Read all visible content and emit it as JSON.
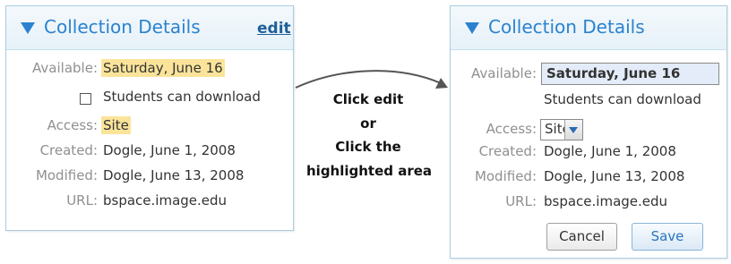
{
  "left_panel": {
    "title": "Collection Details",
    "edit_label": "edit",
    "available_label": "Available:",
    "available_value": "Saturday, June 16",
    "download_label": "Students can download",
    "access_label": "Access:",
    "access_value": "Site",
    "created_label": "Created:",
    "created_value": "Dogle, June 1, 2008",
    "modified_label": "Modified:",
    "modified_value": "Dogle, June 13, 2008",
    "url_label": "URL:",
    "url_value": "bspace.image.edu"
  },
  "right_panel": {
    "title": "Collection Details",
    "available_label": "Available:",
    "available_value": "Saturday, June 16",
    "download_label": "Students can download",
    "access_label": "Access:",
    "access_value": "Site",
    "created_label": "Created:",
    "created_value": "Dogle, June 1, 2008",
    "modified_label": "Modified:",
    "modified_value": "Dogle, June 13, 2008",
    "url_label": "URL:",
    "url_value": "bspace.image.edu",
    "cancel_label": "Cancel",
    "save_label": "Save"
  },
  "instructions": {
    "line1": "Click edit",
    "line2": "or",
    "line3": "Click the",
    "line4": "highlighted area"
  },
  "colors": {
    "accent": "#2a82cf",
    "highlight": "#fbe49a",
    "panel_border": "#a9cde2"
  },
  "icons": [
    "collapse-triangle-icon",
    "dropdown-chevron-icon",
    "arrow-icon"
  ]
}
